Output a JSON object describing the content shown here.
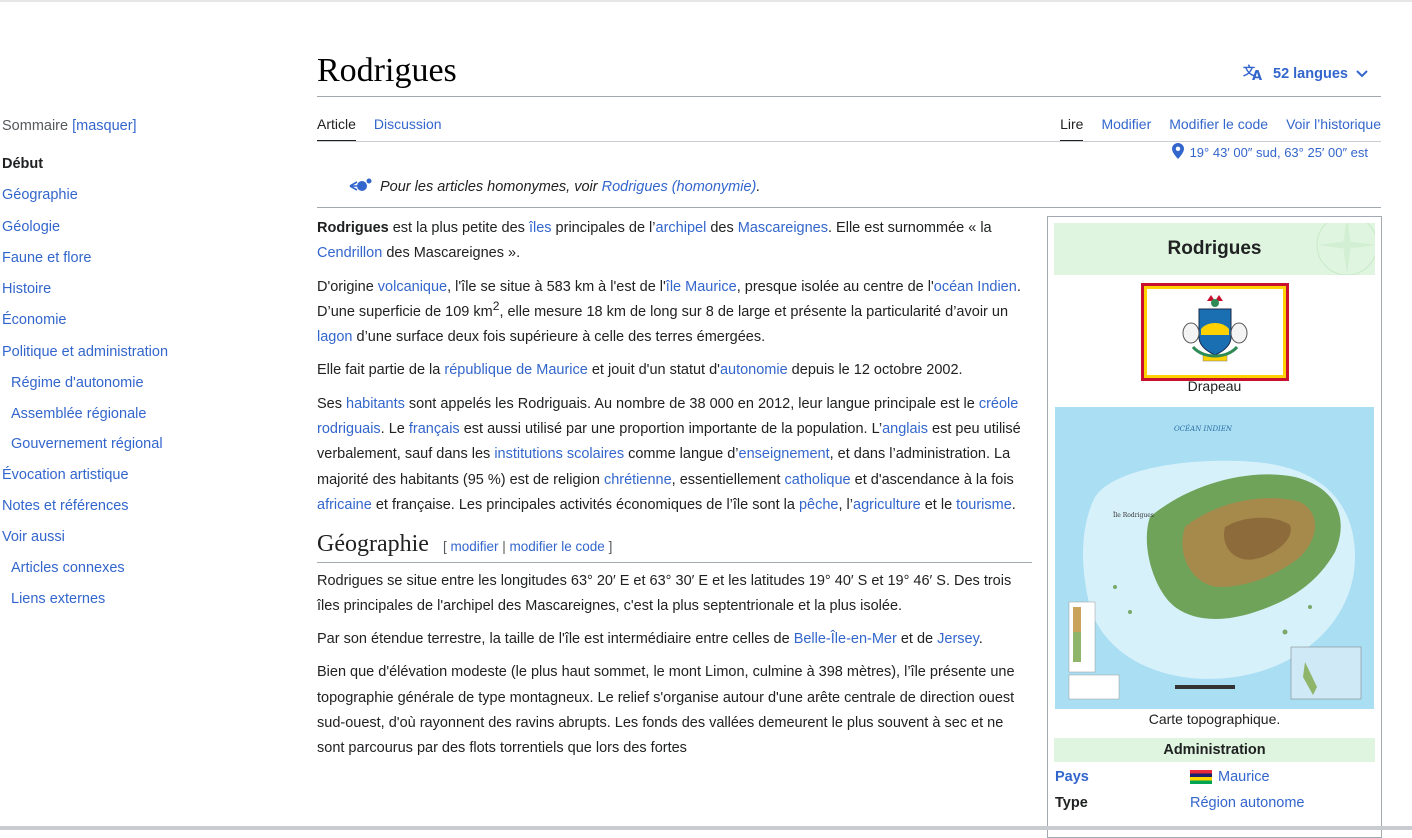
{
  "toc": {
    "heading": "Sommaire",
    "toggle": "[masquer]",
    "items": [
      {
        "label": "Début",
        "level": 1,
        "current": true
      },
      {
        "label": "Géographie",
        "level": 1
      },
      {
        "label": "Géologie",
        "level": 1
      },
      {
        "label": "Faune et flore",
        "level": 1
      },
      {
        "label": "Histoire",
        "level": 1
      },
      {
        "label": "Économie",
        "level": 1
      },
      {
        "label": "Politique et administration",
        "level": 1
      },
      {
        "label": "Régime d'autonomie",
        "level": 2
      },
      {
        "label": "Assemblée régionale",
        "level": 2
      },
      {
        "label": "Gouvernement régional",
        "level": 2
      },
      {
        "label": "Évocation artistique",
        "level": 1
      },
      {
        "label": "Notes et références",
        "level": 1
      },
      {
        "label": "Voir aussi",
        "level": 1
      },
      {
        "label": "Articles connexes",
        "level": 2
      },
      {
        "label": "Liens externes",
        "level": 2
      }
    ]
  },
  "header": {
    "title": "Rodrigues",
    "languages": "52 langues"
  },
  "tabs": {
    "left": [
      {
        "label": "Article",
        "active": true
      },
      {
        "label": "Discussion",
        "active": false
      }
    ],
    "right": [
      {
        "label": "Lire",
        "active": true
      },
      {
        "label": "Modifier",
        "active": false
      },
      {
        "label": "Modifier le code",
        "active": false
      },
      {
        "label": "Voir l’historique",
        "active": false
      }
    ]
  },
  "coordinates": "19° 43′ 00″ sud, 63° 25′ 00″ est",
  "hatnote": {
    "text": "Pour les articles homonymes, voir ",
    "link": "Rodrigues (homonymie)",
    "end": "."
  },
  "content": {
    "paragraphs": [
      [
        {
          "t": "Rodrigues",
          "b": true
        },
        {
          "t": " est la plus petite des "
        },
        {
          "t": "îles",
          "l": true
        },
        {
          "t": " principales de l’"
        },
        {
          "t": "archipel",
          "l": true
        },
        {
          "t": " des "
        },
        {
          "t": "Mascareignes",
          "l": true
        },
        {
          "t": ". Elle est surnommée « la "
        },
        {
          "t": "Cendrillon",
          "l": true
        },
        {
          "t": " des Mascareignes »."
        }
      ],
      [
        {
          "t": "D'origine "
        },
        {
          "t": "volcanique",
          "l": true
        },
        {
          "t": ", l'île se situe à 583 km à l'est de l'"
        },
        {
          "t": "île Maurice",
          "l": true
        },
        {
          "t": ", presque isolée au centre de l'"
        },
        {
          "t": "océan Indien",
          "l": true
        },
        {
          "t": ". D’une superficie de 109 km"
        },
        {
          "t": "2",
          "sup": true
        },
        {
          "t": ", elle mesure 18 km de long sur 8 de large et présente la particularité d’avoir un "
        },
        {
          "t": "lagon",
          "l": true
        },
        {
          "t": " d’une surface deux fois supérieure à celle des terres émergées."
        }
      ],
      [
        {
          "t": "Elle fait partie de la "
        },
        {
          "t": "république de Maurice",
          "l": true
        },
        {
          "t": " et jouit d'un statut d'"
        },
        {
          "t": "autonomie",
          "l": true
        },
        {
          "t": " depuis le 12 octobre 2002."
        }
      ],
      [
        {
          "t": "Ses "
        },
        {
          "t": "habitants",
          "l": true
        },
        {
          "t": " sont appelés les Rodriguais. Au nombre de 38 000 en 2012, leur langue principale est le "
        },
        {
          "t": "créole rodriguais",
          "l": true
        },
        {
          "t": ". Le "
        },
        {
          "t": "français",
          "l": true
        },
        {
          "t": " est aussi utilisé par une proportion importante de la population. L’"
        },
        {
          "t": "anglais",
          "l": true
        },
        {
          "t": " est peu utilisé verbalement, sauf dans les "
        },
        {
          "t": "institutions scolaires",
          "l": true
        },
        {
          "t": " comme langue d’"
        },
        {
          "t": "enseignement",
          "l": true
        },
        {
          "t": ", et dans l’administration. La majorité des habitants (95 %) est de religion "
        },
        {
          "t": "chrétienne",
          "l": true
        },
        {
          "t": ", essentiellement "
        },
        {
          "t": "catholique",
          "l": true
        },
        {
          "t": " et d'ascendance à la fois "
        },
        {
          "t": "africaine",
          "l": true
        },
        {
          "t": " et française. Les principales activités économiques de l’île sont la "
        },
        {
          "t": "pêche",
          "l": true
        },
        {
          "t": ", l’"
        },
        {
          "t": "agriculture",
          "l": true
        },
        {
          "t": " et le "
        },
        {
          "t": "tourisme",
          "l": true
        },
        {
          "t": "."
        }
      ]
    ],
    "section": {
      "heading": "Géographie",
      "edit_open": "[ ",
      "edit_link": "modifier",
      "edit_sep": " | ",
      "edit_code": "modifier le code",
      "edit_close": " ]"
    },
    "section_paragraphs": [
      [
        {
          "t": "Rodrigues se situe entre les longitudes 63° 20′ E et 63° 30′ E et les latitudes 19° 40′ S et 19° 46′ S. Des trois îles principales de l'archipel des Mascareignes, c'est la plus septentrionale et la plus isolée."
        }
      ],
      [
        {
          "t": "Par son étendue terrestre, la taille de l'île est intermédiaire entre celles de "
        },
        {
          "t": "Belle-Île-en-Mer",
          "l": true
        },
        {
          "t": " et de "
        },
        {
          "t": "Jersey",
          "l": true
        },
        {
          "t": "."
        }
      ],
      [
        {
          "t": "Bien que d'élévation modeste (le plus haut sommet, le mont Limon, culmine à 398 mètres), l’île présente une topographie générale de type montagneux. Le relief s'organise autour d'une arête centrale de direction ouest sud-ouest, d'où rayonnent des ravins abrupts. Les fonds des vallées demeurent le plus souvent à sec et ne sont parcourus par des flots torrentiels que lors des fortes"
        }
      ]
    ]
  },
  "infobox": {
    "title": "Rodrigues",
    "flag_caption": "Drapeau",
    "map_caption": "Carte topographique.",
    "map_sea_label": "OCÉAN   INDIEN",
    "map_island_label": "Île Rodrigues",
    "admin_heading": "Administration",
    "rows": [
      {
        "key": "Pays",
        "value": "Maurice",
        "key_link": true,
        "flag": true
      },
      {
        "key": "Type",
        "value": "Région autonome",
        "key_link": false,
        "flag": false
      }
    ]
  },
  "colors": {
    "link": "#3366cc",
    "infobox_header": "#dff5df",
    "text": "#202122"
  }
}
